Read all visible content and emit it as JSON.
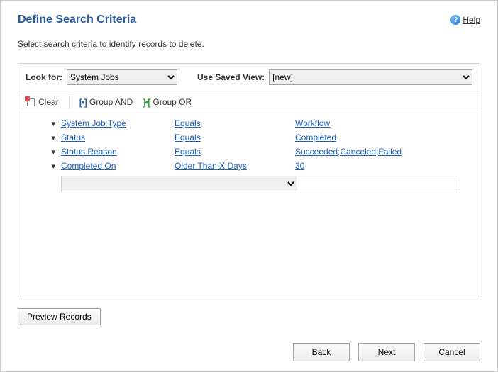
{
  "title": "Define Search Criteria",
  "help": "Help",
  "instruction": "Select search criteria to identify records to delete.",
  "lookfor": {
    "label": "Look for:",
    "value": "System Jobs"
  },
  "savedview": {
    "label": "Use Saved View:",
    "value": "[new]"
  },
  "toolbar": {
    "clear": "Clear",
    "groupand": "Group AND",
    "groupor": "Group OR"
  },
  "criteria": [
    {
      "field": "System Job Type",
      "op": "Equals",
      "val": "Workflow"
    },
    {
      "field": "Status",
      "op": "Equals",
      "val": "Completed"
    },
    {
      "field": "Status Reason",
      "op": "Equals",
      "val": "Succeeded;Canceled;Failed"
    },
    {
      "field": "Completed On",
      "op": "Older Than X Days",
      "val": "30"
    }
  ],
  "preview": "Preview Records",
  "buttons": {
    "back": "Back",
    "next": "Next",
    "cancel": "Cancel"
  }
}
